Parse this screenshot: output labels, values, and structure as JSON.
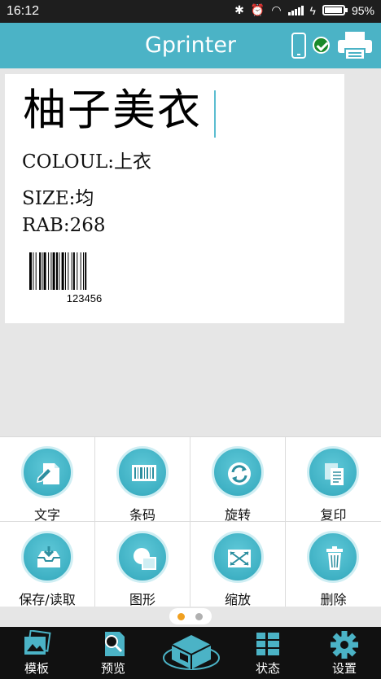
{
  "status_bar": {
    "time": "16:12",
    "battery_percent": "95%",
    "battery_level": 0.95
  },
  "header": {
    "title": "Gprinter"
  },
  "label": {
    "title_text": "柚子美衣",
    "fields": [
      "COLOUL:上衣",
      "SIZE:均",
      "RAB:268"
    ],
    "barcode_number": "123456"
  },
  "tools": [
    {
      "label": "文字",
      "icon": "text-edit-icon"
    },
    {
      "label": "条码",
      "icon": "barcode-icon"
    },
    {
      "label": "旋转",
      "icon": "rotate-icon"
    },
    {
      "label": "复印",
      "icon": "copy-icon"
    },
    {
      "label": "保存/读取",
      "icon": "save-load-icon"
    },
    {
      "label": "图形",
      "icon": "shape-icon"
    },
    {
      "label": "缩放",
      "icon": "zoom-icon"
    },
    {
      "label": "删除",
      "icon": "trash-icon"
    }
  ],
  "pager": {
    "pages": 2,
    "active": 0
  },
  "colors": {
    "accent": "#4bb3c6",
    "pager_active": "#f0a020",
    "pager_inactive": "#b0b0b0"
  },
  "bottom_nav": [
    {
      "label": "模板",
      "icon": "template-icon"
    },
    {
      "label": "预览",
      "icon": "preview-icon"
    },
    {
      "label": "",
      "icon": "print-icon"
    },
    {
      "label": "状态",
      "icon": "status-icon"
    },
    {
      "label": "设置",
      "icon": "settings-icon"
    }
  ]
}
